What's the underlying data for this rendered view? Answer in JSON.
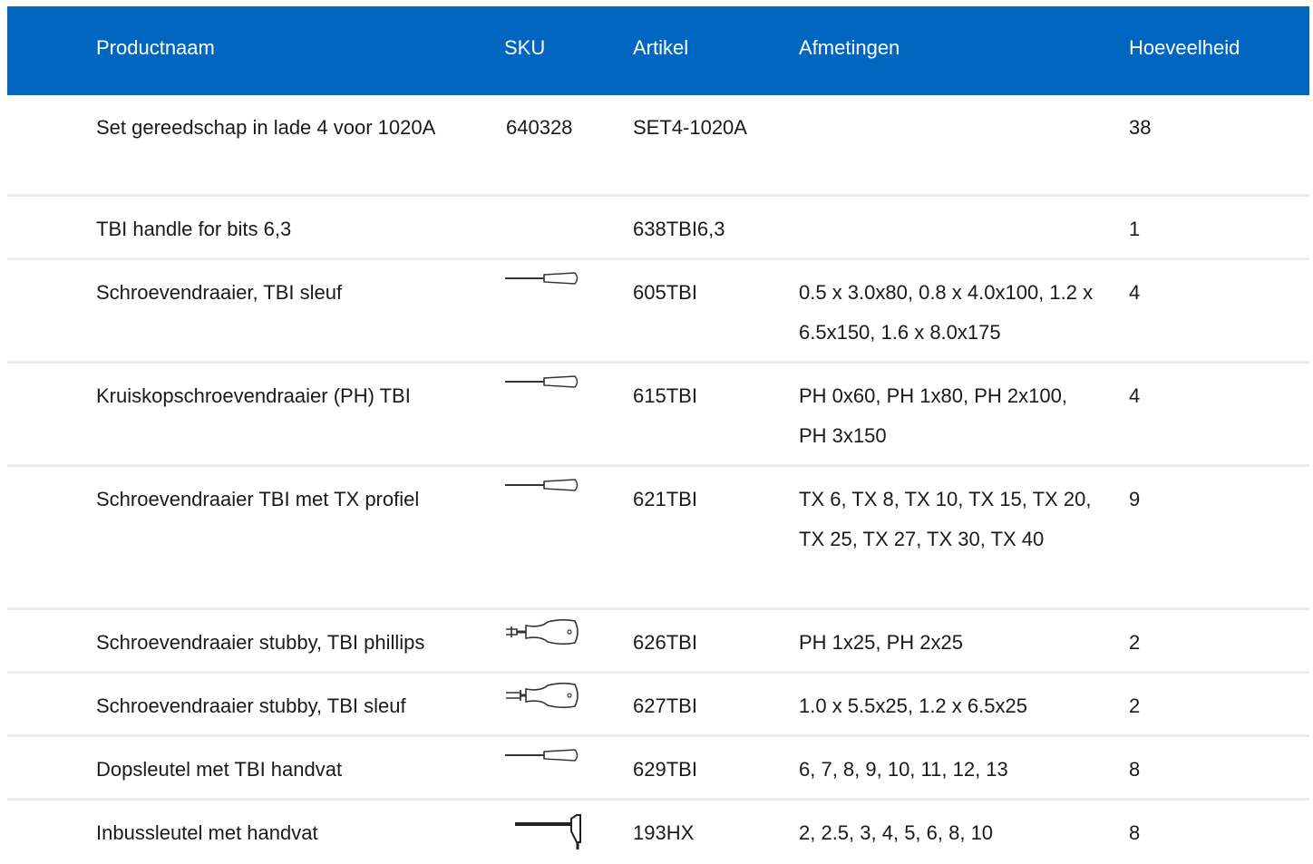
{
  "table": {
    "headers": {
      "name": "Productnaam",
      "sku": "SKU",
      "article": "Artikel",
      "dimensions": "Afmetingen",
      "quantity": "Hoeveelheid"
    },
    "rows": [
      {
        "name": "Set gereedschap in lade 4 voor 1020A",
        "sku": "640328",
        "icon": "none",
        "article": "SET4-1020A",
        "dimensions": "",
        "quantity": "38"
      },
      {
        "name": "TBI handle for bits 6,3",
        "sku": "",
        "icon": "none",
        "article": "638TBI6,3",
        "dimensions": "",
        "quantity": "1"
      },
      {
        "name": "Schroevendraaier, TBI sleuf",
        "sku": "",
        "icon": "screwdriver-icon",
        "article": "605TBI",
        "dimensions": "0.5 x 3.0x80, 0.8 x 4.0x100, 1.2 x 6.5x150, 1.6 x 8.0x175",
        "quantity": "4"
      },
      {
        "name": "Kruiskopschroevendraaier (PH) TBI",
        "sku": "",
        "icon": "screwdriver-icon",
        "article": "615TBI",
        "dimensions": "PH 0x60, PH 1x80, PH 2x100, PH 3x150",
        "quantity": "4"
      },
      {
        "name": "Schroevendraaier TBI met TX profiel",
        "sku": "",
        "icon": "screwdriver-icon",
        "article": "621TBI",
        "dimensions": "TX 6, TX 8, TX 10, TX 15, TX 20, TX 25, TX 27, TX 30, TX 40",
        "quantity": "9"
      },
      {
        "name": "Schroevendraaier stubby, TBI phillips",
        "sku": "",
        "icon": "stubby-phillips-icon",
        "article": "626TBI",
        "dimensions": "PH 1x25, PH 2x25",
        "quantity": "2"
      },
      {
        "name": "Schroevendraaier stubby, TBI sleuf",
        "sku": "",
        "icon": "stubby-slotted-icon",
        "article": "627TBI",
        "dimensions": "1.0 x 5.5x25, 1.2 x 6.5x25",
        "quantity": "2"
      },
      {
        "name": "Dopsleutel met TBI handvat",
        "sku": "",
        "icon": "screwdriver-icon",
        "article": "629TBI",
        "dimensions": "6, 7, 8, 9, 10, 11, 12, 13",
        "quantity": "8"
      },
      {
        "name": "Inbussleutel met handvat",
        "sku": "",
        "icon": "t-handle-hex-key-icon",
        "article": "193HX",
        "dimensions": "2, 2.5, 3, 4, 5, 6, 8, 10",
        "quantity": "8"
      }
    ]
  },
  "colors": {
    "header_bg": "#0066c0",
    "header_text": "#ffffff",
    "row_divider": "#e8ecf0",
    "body_text": "#1a1a1a"
  }
}
